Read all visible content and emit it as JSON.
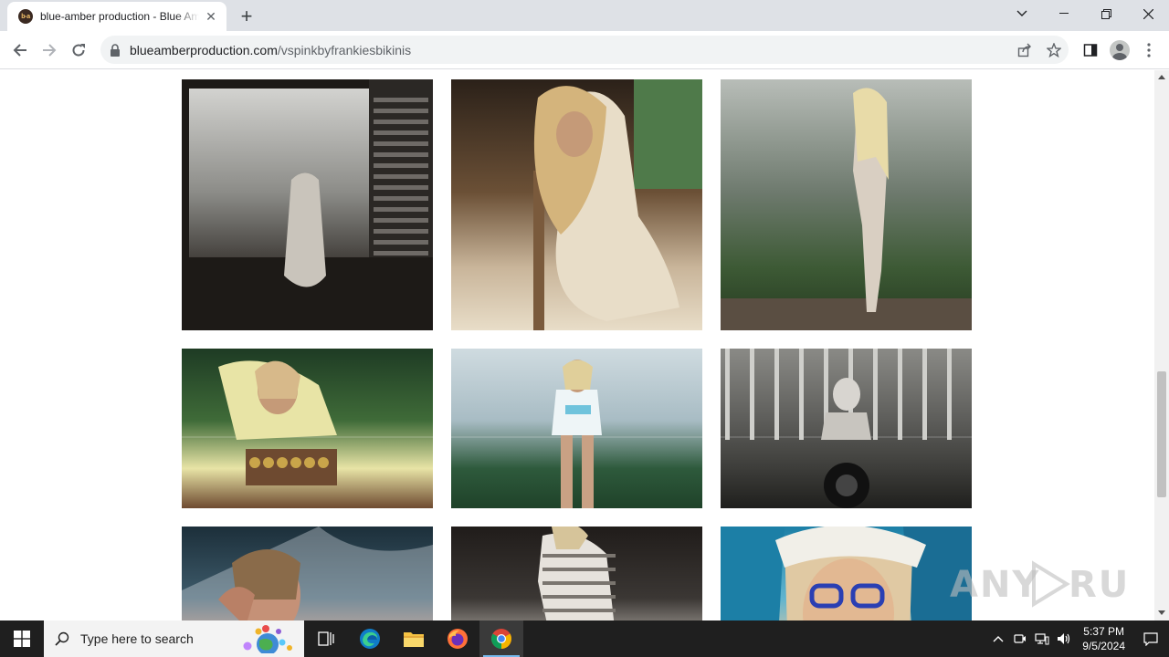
{
  "browser": {
    "tab_title": "blue-amber production - Blue Amber",
    "favicon_text": "b-a",
    "url_domain": "blueamberproduction.com",
    "url_path": "/vspinkbyfrankiesbikinis",
    "icons": {
      "back": "arrow-left-icon",
      "forward": "arrow-right-icon",
      "reload": "reload-icon",
      "share": "share-icon",
      "bookmark": "star-icon",
      "side_panel": "side-panel-icon",
      "profile": "profile-icon",
      "menu": "kebab-menu-icon"
    }
  },
  "gallery": {
    "photos": [
      {
        "name": "photo-woman-window-bw",
        "palette": [
          "#d9d9d6",
          "#8c8c88",
          "#3a3632",
          "#1d1a17"
        ],
        "tone": "bw"
      },
      {
        "name": "photo-woman-chair-interior",
        "palette": [
          "#2b2119",
          "#6b5036",
          "#c9b59a",
          "#e8ddc8"
        ],
        "tone": "warm"
      },
      {
        "name": "photo-woman-jungle-overlook",
        "palette": [
          "#b8bdb8",
          "#6e7a6e",
          "#3d5a35",
          "#24381f"
        ],
        "tone": "green"
      },
      {
        "name": "photo-woman-yellow-sweater",
        "palette": [
          "#1e3b24",
          "#3f6b38",
          "#e8e4a6",
          "#6e4a30"
        ],
        "tone": "green"
      },
      {
        "name": "photo-woman-cloudy-sky",
        "palette": [
          "#cfdbe0",
          "#a8bcc4",
          "#2e5a3c",
          "#1f4229"
        ],
        "tone": "sky"
      },
      {
        "name": "photo-woman-motorcycle-bw",
        "palette": [
          "#8a8a86",
          "#5d5d5a",
          "#3d3d3a",
          "#1f1f1d"
        ],
        "tone": "bw"
      },
      {
        "name": "photo-woman-waterfall",
        "palette": [
          "#1c2f3a",
          "#3e5b6b",
          "#c59177",
          "#e8e8e8"
        ],
        "tone": "cool"
      },
      {
        "name": "photo-woman-striped-shirt",
        "palette": [
          "#201c1a",
          "#3b3734",
          "#b9b4ad",
          "#e6e2dc"
        ],
        "tone": "dark"
      },
      {
        "name": "photo-woman-blue-glasses",
        "palette": [
          "#1c7fa6",
          "#60b4cf",
          "#e0c9a3",
          "#2a3fb3"
        ],
        "tone": "blue"
      }
    ]
  },
  "taskbar": {
    "search_placeholder": "Type here to search",
    "time": "5:37 PM",
    "date": "9/5/2024",
    "apps": [
      "task-view-icon",
      "edge-icon",
      "file-explorer-icon",
      "firefox-icon",
      "chrome-icon"
    ]
  },
  "watermark": "ANY RUN"
}
